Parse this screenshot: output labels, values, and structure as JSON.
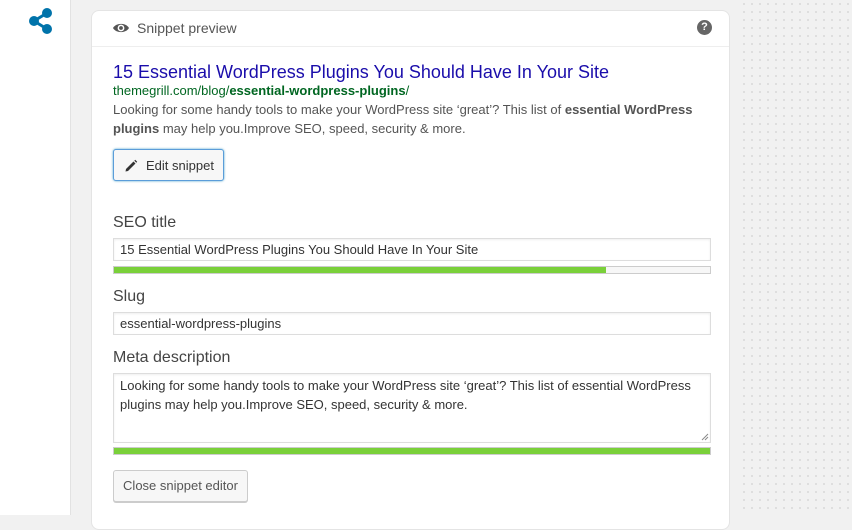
{
  "colors": {
    "accent": "#0073aa",
    "link_title": "#1a0dab",
    "url_green": "#006621",
    "progress_green": "#7ad03a"
  },
  "sidebar": {
    "icon": "share-icon"
  },
  "snippet_preview": {
    "header_icon": "eye-icon",
    "header_title": "Snippet preview",
    "help_icon": "question-mark-icon",
    "help_label": "?",
    "title": "15 Essential WordPress Plugins You Should Have In Your Site",
    "url_base": "themegrill.com/blog/",
    "url_slug": "essential-wordpress-plugins",
    "url_trailing": "/",
    "description_part1": "Looking for some handy tools to make your WordPress site ‘great’? This list of ",
    "description_bold": "essential WordPress plugins",
    "description_part2": " may help you.Improve SEO, speed, security & more.",
    "edit_button_icon": "pencil-icon",
    "edit_button_label": "Edit snippet"
  },
  "editor": {
    "seo_title_label": "SEO title",
    "seo_title_value": "15 Essential WordPress Plugins You Should Have In Your Site",
    "seo_title_progress": 0.825,
    "slug_label": "Slug",
    "slug_value": "essential-wordpress-plugins",
    "meta_label": "Meta description",
    "meta_value": "Looking for some handy tools to make your WordPress site ‘great’? This list of essential WordPress plugins may help you.Improve SEO, speed, security & more.",
    "meta_progress": 1.0,
    "close_button_label": "Close snippet editor"
  }
}
